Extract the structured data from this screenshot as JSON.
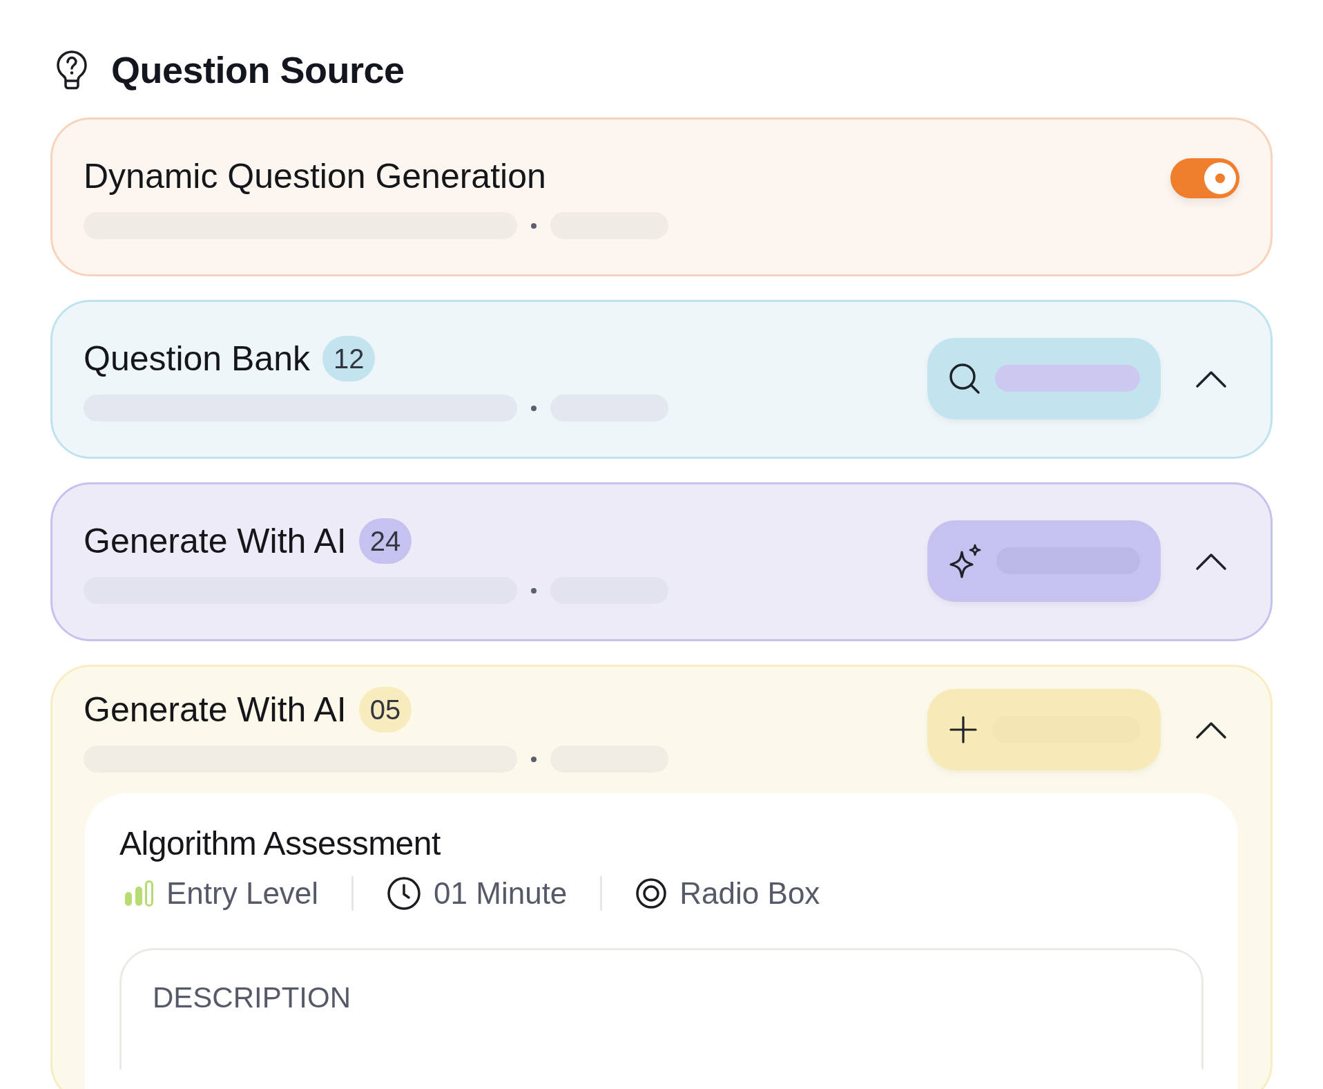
{
  "heading": "Question Source",
  "sources": [
    {
      "kind": "toggle",
      "title": "Dynamic Question Generation",
      "on": true
    },
    {
      "kind": "search",
      "title": "Question Bank",
      "count": "12",
      "expanded": true
    },
    {
      "kind": "ai",
      "title": "Generate With AI",
      "count": "24",
      "expanded": true
    },
    {
      "kind": "add",
      "title": "Generate With AI",
      "count": "05",
      "expanded": true,
      "question": {
        "title": "Algorithm Assessment",
        "meta": [
          {
            "kind": "level",
            "label": "Entry Level"
          },
          {
            "kind": "time",
            "label": "01 Minute"
          },
          {
            "kind": "radio",
            "label": "Radio Box"
          }
        ],
        "section_label": "DESCRIPTION"
      }
    }
  ]
}
